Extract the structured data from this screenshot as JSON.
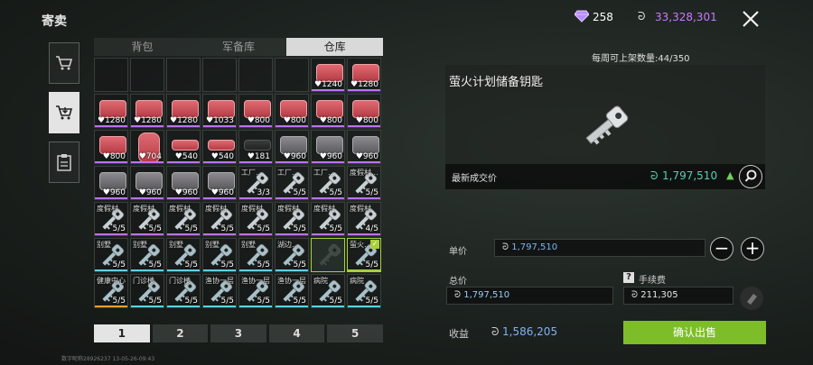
{
  "header": {
    "title": "寄卖",
    "gem_count": "258",
    "coin_symbol": "ᘒ",
    "coin_count": "33,328,301"
  },
  "tabs": [
    {
      "label": "背包"
    },
    {
      "label": "军备库"
    },
    {
      "label": "仓库"
    }
  ],
  "grid": {
    "rows": [
      [
        {
          "type": "empty"
        },
        {
          "type": "empty"
        },
        {
          "type": "empty"
        },
        {
          "type": "empty"
        },
        {
          "type": "empty"
        },
        {
          "type": "empty"
        },
        {
          "type": "case",
          "qty": "♥1240"
        },
        {
          "type": "case",
          "qty": "♥1280"
        }
      ],
      [
        {
          "type": "case",
          "qty": "♥1280"
        },
        {
          "type": "case",
          "qty": "♥1280"
        },
        {
          "type": "case",
          "qty": "♥1280"
        },
        {
          "type": "case",
          "qty": "♥1033"
        },
        {
          "type": "case",
          "qty": "♥800"
        },
        {
          "type": "case",
          "qty": "♥800"
        },
        {
          "type": "case",
          "qty": "♥800"
        },
        {
          "type": "case",
          "qty": "♥800"
        }
      ],
      [
        {
          "type": "case",
          "qty": "♥800"
        },
        {
          "type": "tall",
          "qty": "♥704"
        },
        {
          "type": "flat",
          "qty": "♥540"
        },
        {
          "type": "flat",
          "qty": "♥540"
        },
        {
          "type": "dark",
          "qty": "♥181"
        },
        {
          "type": "grey",
          "qty": "♥960"
        },
        {
          "type": "grey",
          "qty": "♥960"
        },
        {
          "type": "grey",
          "qty": "♥960"
        }
      ],
      [
        {
          "type": "grey",
          "qty": "♥960"
        },
        {
          "type": "grey",
          "qty": "♥960"
        },
        {
          "type": "grey",
          "qty": "♥960"
        },
        {
          "type": "grey",
          "qty": "♥960"
        },
        {
          "type": "key",
          "label": "工厂...",
          "qty": "3/3"
        },
        {
          "type": "key",
          "label": "工厂...",
          "qty": "5/5"
        },
        {
          "type": "key",
          "label": "工厂...",
          "qty": "5/5"
        },
        {
          "type": "key",
          "label": "度假村...",
          "qty": "5/5"
        }
      ],
      [
        {
          "type": "key",
          "label": "度假村",
          "qty": "5/5"
        },
        {
          "type": "key",
          "label": "度假村",
          "qty": "5/5"
        },
        {
          "type": "key",
          "label": "度假村",
          "qty": "5/5"
        },
        {
          "type": "key",
          "label": "度假村",
          "qty": "5/5"
        },
        {
          "type": "key",
          "label": "度假村",
          "qty": "5/5"
        },
        {
          "type": "key",
          "label": "度假村",
          "qty": "5/5"
        },
        {
          "type": "key",
          "label": "度假村",
          "qty": "5/5"
        },
        {
          "type": "key",
          "label": "度假村",
          "qty": "4/5"
        }
      ],
      [
        {
          "type": "key",
          "label": "别墅",
          "qty": "5/5"
        },
        {
          "type": "key",
          "label": "别墅",
          "qty": "5/5"
        },
        {
          "type": "key",
          "label": "别墅",
          "qty": "5/5"
        },
        {
          "type": "key",
          "label": "别墅",
          "qty": "5/5"
        },
        {
          "type": "key",
          "label": "别墅",
          "qty": "5/5"
        },
        {
          "type": "key",
          "label": "湖边...",
          "qty": "5/5"
        },
        {
          "type": "keydark",
          "label": "",
          "qty": ""
        },
        {
          "type": "keysel",
          "label": "萤火...",
          "qty": "5/5"
        }
      ],
      [
        {
          "type": "key",
          "label": "健康中心",
          "qty": "5/5"
        },
        {
          "type": "key",
          "label": "门诊楼",
          "qty": "5/5"
        },
        {
          "type": "key",
          "label": "门诊楼",
          "qty": "5/5"
        },
        {
          "type": "key",
          "label": "渔协一层",
          "qty": "5/5"
        },
        {
          "type": "key",
          "label": "渔协一层",
          "qty": "5/5"
        },
        {
          "type": "key",
          "label": "渔协一层",
          "qty": "5/5"
        },
        {
          "type": "key",
          "label": "病院",
          "qty": "5/5"
        },
        {
          "type": "key",
          "label": "病院",
          "qty": "5/5"
        }
      ]
    ]
  },
  "pages": [
    "1",
    "2",
    "3",
    "4",
    "5"
  ],
  "footer": "数字昵称28926237 13-05-26-09:43",
  "right": {
    "weekly_limit": "每周可上架数量:44/350",
    "item_name": "萤火计划储备钥匙",
    "last_price_label": "最新成交价",
    "last_price_value": "1,797,510",
    "unit_price_label": "单价",
    "unit_price_value": "1,797,510",
    "total_label": "总价",
    "total_value": "1,797,510",
    "fee_label": "手续费",
    "fee_value": "211,305",
    "profit_label": "收益",
    "profit_value": "1,586,205",
    "confirm_label": "确认出售",
    "minus": "−",
    "plus": "+"
  },
  "colors": {
    "accent_green": "#7dbd2a",
    "price_teal": "#55d0b0",
    "coin_purple": "#c77bff"
  }
}
